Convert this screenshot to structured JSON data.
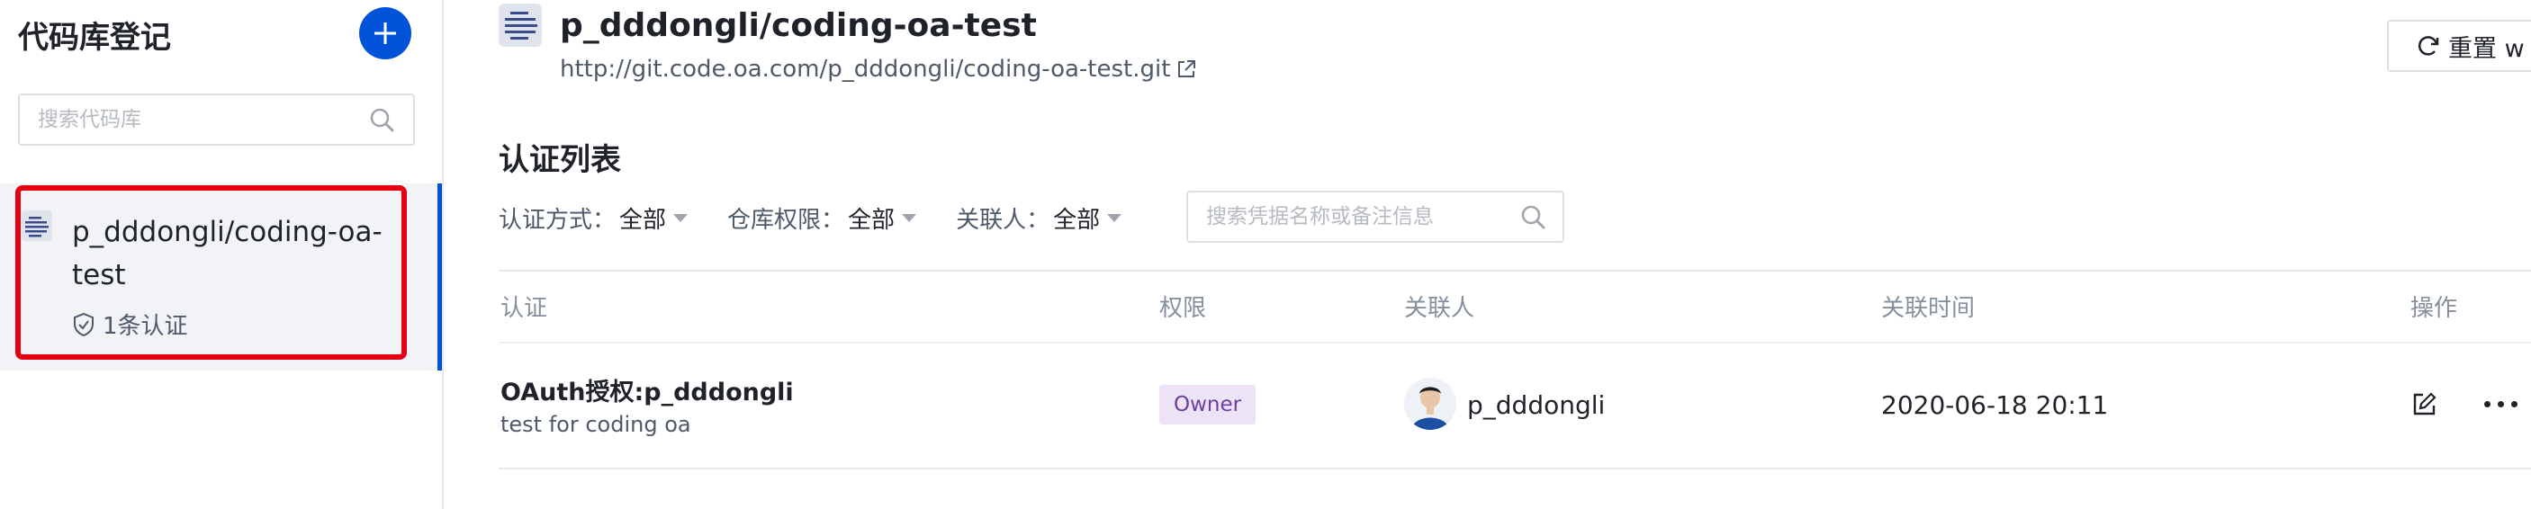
{
  "sidebar": {
    "title": "代码库登记",
    "search_placeholder": "搜索代码库",
    "repo": {
      "name": "p_dddongli/coding-oa-test",
      "auth_count": "1条认证"
    }
  },
  "header": {
    "title": "p_dddongli/coding-oa-test",
    "url": "http://git.code.oa.com/p_dddongli/coding-oa-test.git",
    "reset_label": "重置 w"
  },
  "section": {
    "title": "认证列表",
    "filters": [
      {
        "label": "认证方式：",
        "value": "全部"
      },
      {
        "label": "仓库权限：",
        "value": "全部"
      },
      {
        "label": "关联人：",
        "value": "全部"
      }
    ],
    "search_placeholder": "搜索凭据名称或备注信息"
  },
  "table": {
    "columns": [
      "认证",
      "权限",
      "关联人",
      "关联时间",
      "操作"
    ],
    "rows": [
      {
        "auth": "OAuth授权:p_dddongli",
        "desc": "test for coding oa",
        "permission": "Owner",
        "user": "p_dddongli",
        "time": "2020-06-18 20:11"
      }
    ]
  },
  "colors": {
    "accent": "#0052d9",
    "highlight": "#e60012",
    "badge_bg": "#ede3f7",
    "badge_text": "#6b3fa0"
  },
  "icons": [
    "plus-icon",
    "search-icon",
    "repo-icon",
    "shield-check-icon",
    "external-link-icon",
    "refresh-icon",
    "caret-down-icon",
    "edit-icon",
    "more-icon"
  ]
}
